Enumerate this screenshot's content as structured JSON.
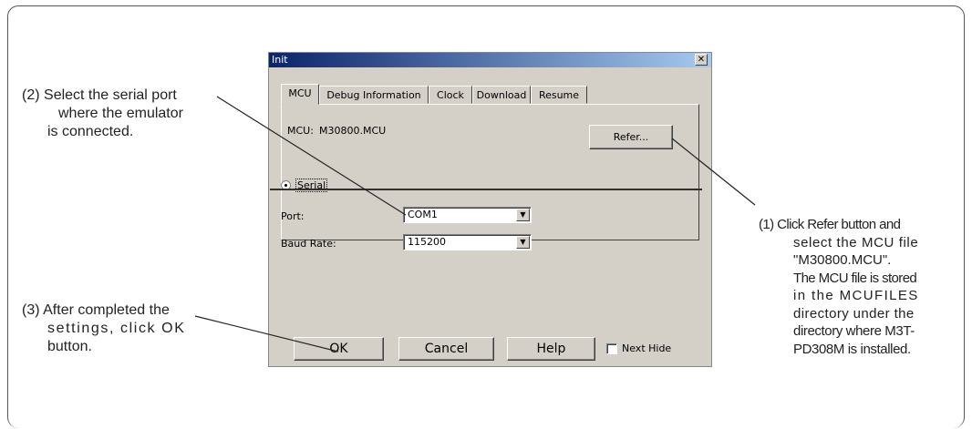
{
  "dialog": {
    "title": "Init",
    "close_glyph": "✕",
    "tabs": [
      "MCU",
      "Debug Information",
      "Clock",
      "Download",
      "Resume"
    ],
    "mcu_label": "MCU:",
    "mcu_value": "M30800.MCU",
    "refer_button": "Refer...",
    "serial_label": "Serial",
    "serial_selected": true,
    "port_label": "Port:",
    "port_value": "COM1",
    "baud_label": "Baud Rate:",
    "baud_value": "115200",
    "ok_button": "OK",
    "cancel_button": "Cancel",
    "help_button": "Help",
    "next_hide_label": "Next Hide",
    "next_hide_checked": false
  },
  "annotations": {
    "step2": {
      "num": "(2)",
      "lines": [
        "Select the serial port",
        "where the emulator",
        "is connected."
      ]
    },
    "step3": {
      "num": "(3)",
      "lines": [
        "After completed the",
        "settings, click OK",
        "button."
      ]
    },
    "step1": {
      "num": "(1)",
      "lines": [
        "Click Refer button and",
        "select the MCU file",
        "\"M30800.MCU\".",
        "The MCU file is stored",
        "in the MCUFILES",
        "directory under the",
        "directory where M3T-",
        "PD308M is installed."
      ]
    }
  },
  "icons": {
    "combo_arrow": "dropdown-arrow-icon",
    "close": "close-icon"
  }
}
